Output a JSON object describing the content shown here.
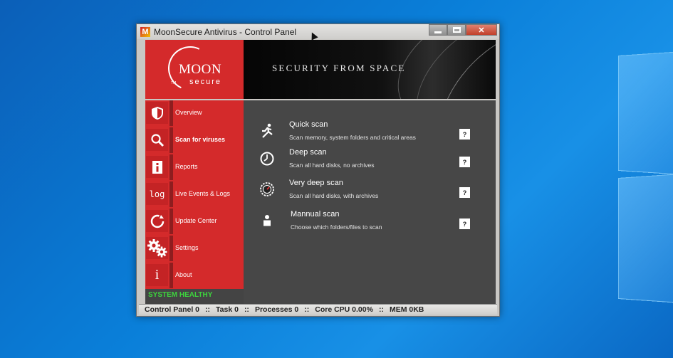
{
  "window": {
    "title": "MoonSecure Antivirus - Control Panel",
    "icon_letter": "M",
    "controls": {
      "minimize": "minimize-icon",
      "maximize": "maximize-icon",
      "close": "✕"
    }
  },
  "logo": {
    "moon": "MOON",
    "secure": "secure",
    "tm": "TM"
  },
  "banner": {
    "tagline": "SECURITY FROM SPACE"
  },
  "sidebar": {
    "items": [
      {
        "label": "Overview",
        "icon": "shield-icon",
        "active": false
      },
      {
        "label": "Scan for viruses",
        "icon": "search-icon",
        "active": true
      },
      {
        "label": "Reports",
        "icon": "report-icon",
        "active": false
      },
      {
        "label": "Live Events & Logs",
        "icon": "log-icon",
        "active": false
      },
      {
        "label": "Update Center",
        "icon": "refresh-icon",
        "active": false
      },
      {
        "label": "Settings",
        "icon": "gear-icon",
        "active": false
      },
      {
        "label": "About",
        "icon": "info-icon",
        "active": false
      }
    ],
    "log_glyph": "log",
    "info_glyph": "i",
    "status": "SYSTEM HEALTHY"
  },
  "scans": [
    {
      "title": "Quick scan",
      "description": "Scan memory, system folders and critical areas",
      "icon": "runner-icon",
      "help": "?"
    },
    {
      "title": "Deep scan",
      "description": "Scan all hard disks, no archives",
      "icon": "stopwatch-icon",
      "help": "?"
    },
    {
      "title": "Very deep scan",
      "description": "Scan all hard disks, with archives",
      "icon": "dial-icon",
      "help": "?"
    },
    {
      "title": "Mannual scan",
      "description": "Choose which folders/files to scan",
      "icon": "person-icon",
      "help": "?"
    }
  ],
  "statusbar": {
    "control_panel": "Control Panel 0",
    "task": "Task 0",
    "processes": "Processes 0",
    "core_cpu": "Core CPU 0.00%",
    "mem": "MEM 0KB",
    "separator": "::"
  },
  "colors": {
    "brand_red": "#d42a2b",
    "panel_gray": "#474747",
    "healthy_green": "#3dd33d"
  }
}
